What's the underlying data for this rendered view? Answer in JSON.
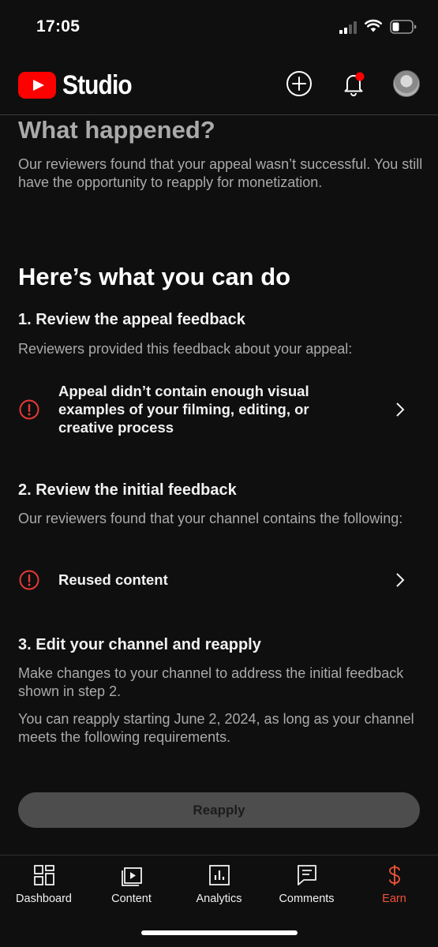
{
  "status_bar": {
    "time": "17:05"
  },
  "header": {
    "brand": "Studio",
    "icons": {
      "logo": "youtube-logo",
      "create": "create-plus-icon",
      "notifications": "bell-icon",
      "avatar": "avatar"
    }
  },
  "what_happened": {
    "title": "What happened?",
    "body": "Our reviewers found that your appeal wasn’t successful. You still have the opportunity to reapply for monetization."
  },
  "actions": {
    "title": "Here’s what you can do",
    "step1": {
      "title": "1. Review the appeal feedback",
      "body": "Reviewers provided this feedback about your appeal:",
      "issue": "Appeal didn’t contain enough visual examples of your filming, editing, or creative process"
    },
    "step2": {
      "title": "2. Review the initial feedback",
      "body": "Our reviewers found that your channel contains the following:",
      "issue": "Reused content"
    },
    "step3": {
      "title": "3. Edit your channel and reapply",
      "body": "Make changes to your channel to address the initial feedback shown in step 2.",
      "body2": "You can reapply starting June 2, 2024, as long as your channel meets the following requirements."
    },
    "reapply_label": "Reapply"
  },
  "bottom_nav": {
    "items": [
      {
        "label": "Dashboard",
        "icon": "dashboard-icon"
      },
      {
        "label": "Content",
        "icon": "content-icon"
      },
      {
        "label": "Analytics",
        "icon": "analytics-icon"
      },
      {
        "label": "Comments",
        "icon": "comments-icon"
      },
      {
        "label": "Earn",
        "icon": "earn-icon",
        "active": true
      }
    ]
  },
  "colors": {
    "accent_red": "#ff0000",
    "error_red": "#e53935",
    "earn_active": "#f0533a",
    "background": "#0f0f0f"
  }
}
